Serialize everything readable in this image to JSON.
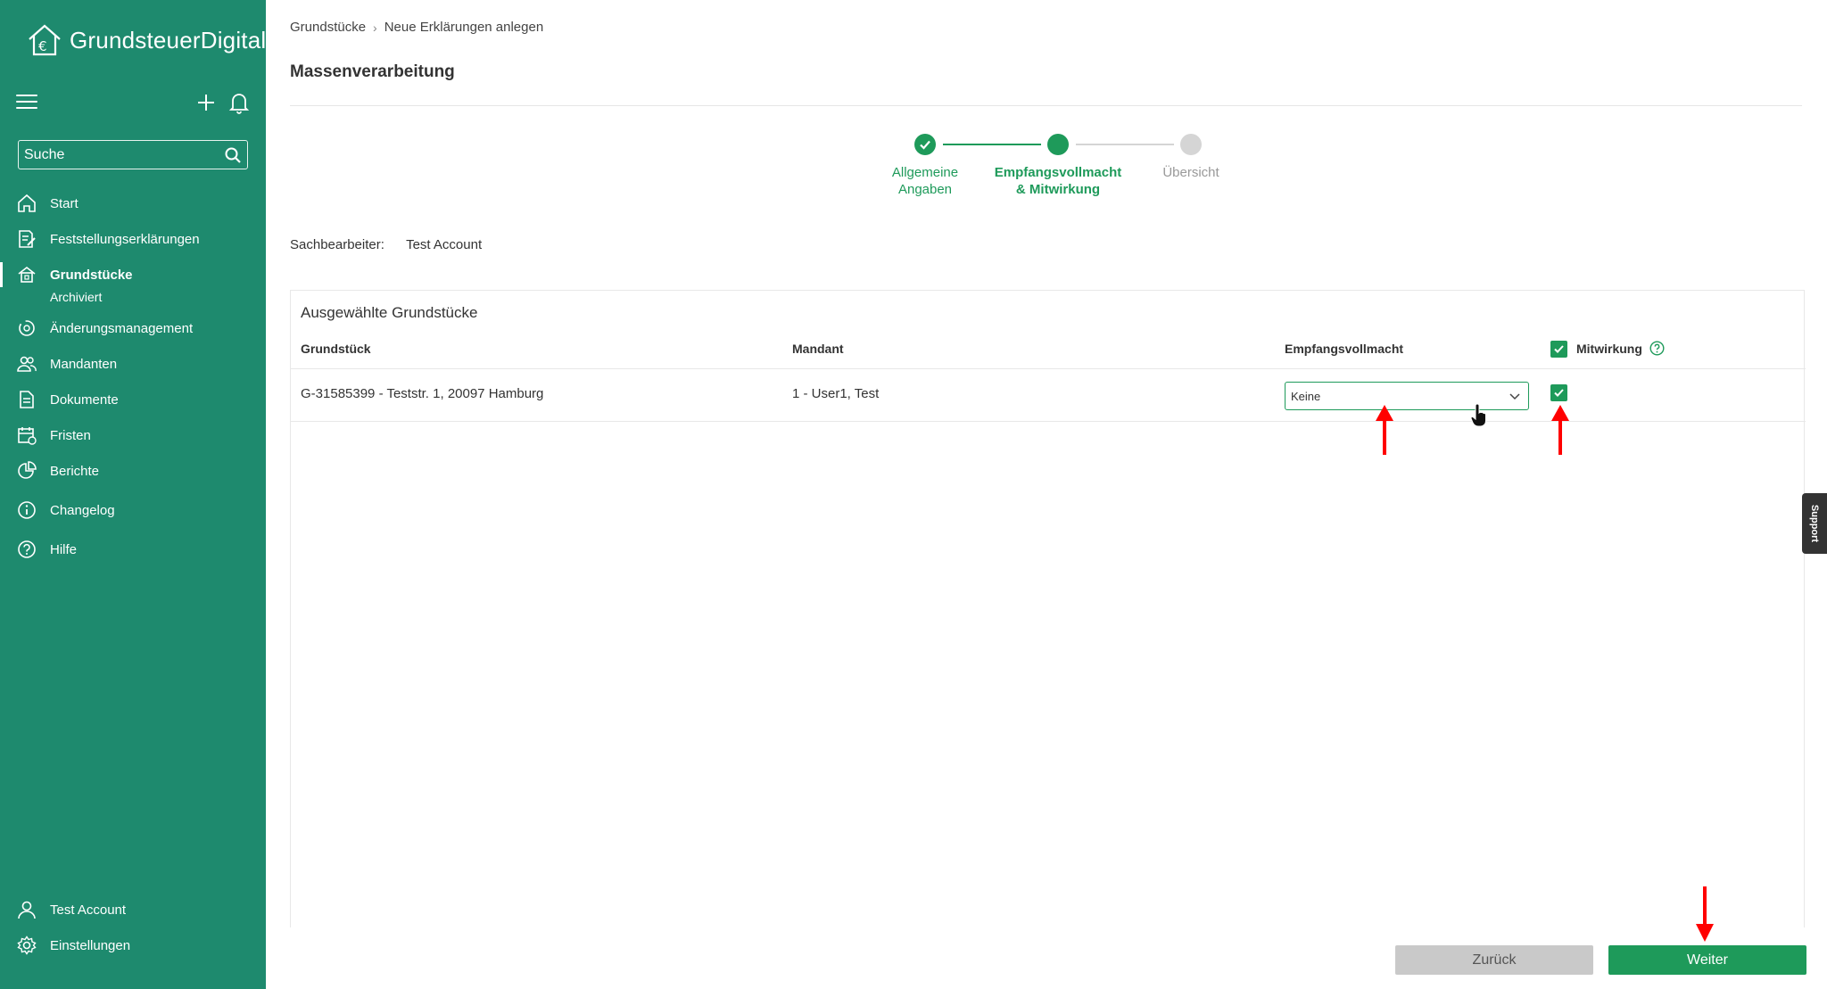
{
  "app": {
    "name": "GrundsteuerDigital"
  },
  "sidebar": {
    "search_placeholder": "Suche",
    "items": [
      {
        "label": "Start",
        "icon": "home-icon"
      },
      {
        "label": "Feststellungserklärungen",
        "icon": "document-edit-icon"
      },
      {
        "label": "Grundstücke",
        "icon": "property-icon",
        "active": true
      },
      {
        "label": "Änderungsmanagement",
        "icon": "change-icon"
      },
      {
        "label": "Mandanten",
        "icon": "users-icon"
      },
      {
        "label": "Dokumente",
        "icon": "document-icon"
      },
      {
        "label": "Fristen",
        "icon": "calendar-icon"
      },
      {
        "label": "Berichte",
        "icon": "pie-chart-icon"
      },
      {
        "label": "Changelog",
        "icon": "info-icon"
      },
      {
        "label": "Hilfe",
        "icon": "help-icon"
      }
    ],
    "sub_items": {
      "grundstuecke": "Archiviert"
    },
    "bottom": [
      {
        "label": "Test Account",
        "icon": "user-icon"
      },
      {
        "label": "Einstellungen",
        "icon": "gear-icon"
      }
    ]
  },
  "breadcrumb": [
    "Grundstücke",
    "Neue Erklärungen anlegen"
  ],
  "page_title": "Massenverarbeitung",
  "stepper": {
    "steps": [
      {
        "label_line1": "Allgemeine",
        "label_line2": "Angaben",
        "state": "done"
      },
      {
        "label_line1": "Empfangsvollmacht",
        "label_line2": "& Mitwirkung",
        "state": "current"
      },
      {
        "label_line1": "Übersicht",
        "label_line2": "",
        "state": "pending"
      }
    ]
  },
  "sachbearbeiter": {
    "label": "Sachbearbeiter:",
    "value": "Test Account"
  },
  "table": {
    "title": "Ausgewählte Grundstücke",
    "columns": [
      "Grundstück",
      "Mandant",
      "Empfangsvollmacht",
      "Mitwirkung"
    ],
    "rows": [
      {
        "grundstueck": "G-31585399 - Teststr. 1, 20097 Hamburg",
        "mandant": "1 - User1, Test",
        "empfangsvollmacht": "Keine",
        "mitwirkung": true
      }
    ],
    "header_mitwirkung_checked": true
  },
  "buttons": {
    "back": "Zurück",
    "next": "Weiter"
  },
  "support_tab": "Support",
  "colors": {
    "sidebar": "#1e8a6e",
    "accent": "#1e9a5a",
    "annotation_arrow": "#ff0000"
  }
}
